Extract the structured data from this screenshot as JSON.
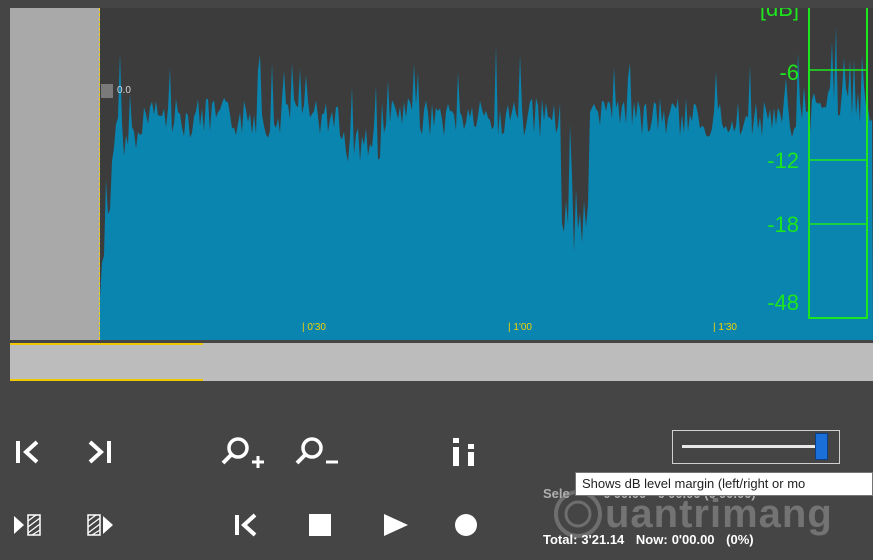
{
  "waveform": {
    "zero_label": "0.0",
    "db_scale": [
      "[dB]",
      "-6",
      "-12",
      "-18",
      "-48"
    ],
    "time_ticks": [
      "| 0'30",
      "| 1'00",
      "| 1'30"
    ]
  },
  "transport": {
    "icons": [
      "skip-to-start-icon",
      "skip-to-end-icon",
      "zoom-in-icon",
      "zoom-out-icon",
      "level-bars-icon",
      "mark-start-icon",
      "mark-end-icon",
      "rewind-icon",
      "stop-icon",
      "play-icon",
      "record-icon"
    ]
  },
  "level_margin": {
    "tooltip": "Shows dB level margin (left/right or mo",
    "slider_value_fraction": 0.95
  },
  "status": {
    "selection_label": "Sele",
    "selection_values": "0'00.00 - 0'00.00 (0'00.00)",
    "total_label": "Total:",
    "total_value": "3'21.14",
    "now_label": "Now:",
    "now_value": "0'00.00",
    "percent": "(0%)"
  },
  "watermark": {
    "text": "uantrimang"
  },
  "colors": {
    "wave_fill": "#0a85b0",
    "db_green": "#1ee61e",
    "time_tick_yellow": "#f2d200",
    "background": "#454545",
    "slider_blue": "#1a6fd8"
  }
}
